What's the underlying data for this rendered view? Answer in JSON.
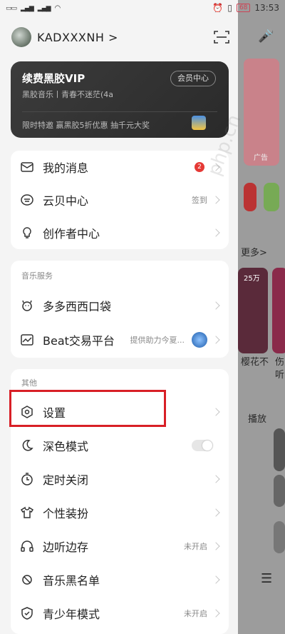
{
  "status_bar": {
    "left_icons": [
      "sim-icon",
      "sim-icon",
      "signal-icon",
      "signal-icon",
      "wifi-icon"
    ],
    "battery": "68",
    "time": "13:53"
  },
  "profile": {
    "username": "KADXXXNH >"
  },
  "vip": {
    "title": "续费黑胶VIP",
    "subtitle": "黑胶音乐丨青春不迷茫(4a",
    "center_button": "会员中心",
    "promo": "限时特邀 赢黑胶5折优惠 抽千元大奖"
  },
  "menu_main": [
    {
      "label": "我的消息",
      "icon": "mail-icon",
      "badge": "2"
    },
    {
      "label": "云贝中心",
      "icon": "coin-icon",
      "aux": "签到"
    },
    {
      "label": "创作者中心",
      "icon": "bulb-icon"
    }
  ],
  "music_services": {
    "header": "音乐服务",
    "items": [
      {
        "label": "多多西西口袋",
        "icon": "pet-icon"
      },
      {
        "label": "Beat交易平台",
        "icon": "chart-icon",
        "aux": "提供助力今夏..."
      }
    ]
  },
  "other": {
    "header": "其他",
    "items": [
      {
        "label": "设置",
        "icon": "settings-icon"
      },
      {
        "label": "深色模式",
        "icon": "moon-icon"
      },
      {
        "label": "定时关闭",
        "icon": "timer-icon"
      },
      {
        "label": "个性装扮",
        "icon": "shirt-icon"
      },
      {
        "label": "边听边存",
        "icon": "headphone-icon",
        "aux": "未开启"
      },
      {
        "label": "音乐黑名单",
        "icon": "block-icon"
      },
      {
        "label": "青少年模式",
        "icon": "shield-icon",
        "aux": "未开启"
      }
    ]
  },
  "background_app": {
    "more": "更多>",
    "count": "25万",
    "t1": "樱花不",
    "t2": "伤",
    "t3": "听",
    "play": "播放",
    "ad": "广告"
  },
  "watermark": "php.cn"
}
